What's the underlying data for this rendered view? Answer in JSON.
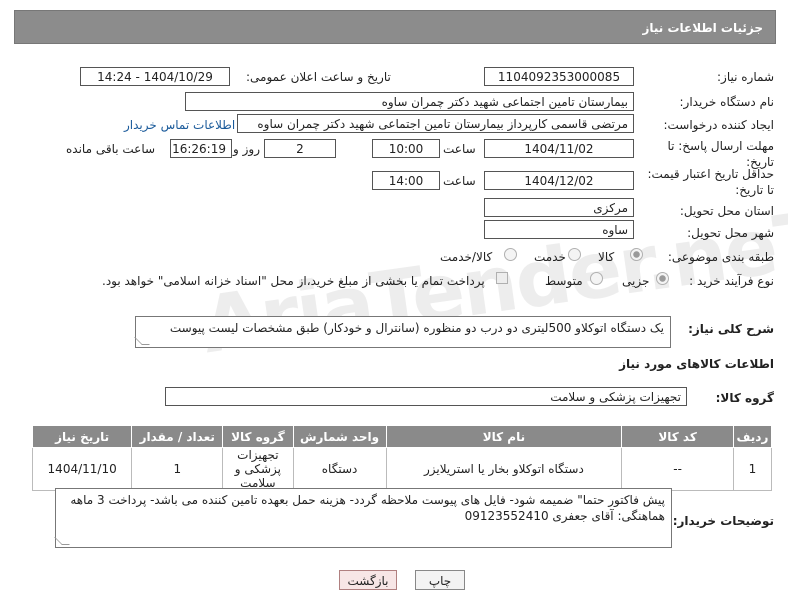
{
  "header": {
    "title": "جزئیات اطلاعات نیاز"
  },
  "need_number": {
    "label": "شماره نیاز:",
    "value": "1104092353000085"
  },
  "announce": {
    "label": "تاریخ و ساعت اعلان عمومی:",
    "value": "1404/10/29 - 14:24"
  },
  "buyer_org": {
    "label": "نام دستگاه خریدار:",
    "value": "بیمارستان تامین اجتماعی شهید دکتر چمران ساوه"
  },
  "requester": {
    "label": "ایجاد کننده درخواست:",
    "value": "مرتضی قاسمی کارپرداز بیمارستان تامین اجتماعی شهید دکتر چمران ساوه",
    "contact_link": "اطلاعات تماس خریدار"
  },
  "reply_deadline": {
    "label_line1": "مهلت ارسال پاسخ: تا",
    "label_line2": "تاریخ:",
    "date": "1404/11/02",
    "time_label": "ساعت",
    "time": "10:00",
    "days": "2",
    "days_label": "روز و",
    "remaining": "16:26:19",
    "remaining_label": "ساعت باقی مانده"
  },
  "price_validity": {
    "label_line1": "حداقل تاریخ اعتبار قیمت:",
    "label_line2": "تا تاریخ:",
    "date": "1404/12/02",
    "time_label": "ساعت",
    "time": "14:00"
  },
  "province": {
    "label": "استان محل تحویل:",
    "value": "مرکزی"
  },
  "city": {
    "label": "شهر محل تحویل:",
    "value": "ساوه"
  },
  "category": {
    "label": "طبقه بندی موضوعی:",
    "options": [
      "کالا",
      "خدمت",
      "کالا/خدمت"
    ],
    "selected": "کالا"
  },
  "process": {
    "label": "نوع فرآیند خرید :",
    "options": [
      "جزیی",
      "متوسط"
    ],
    "payment_note": "پرداخت تمام یا بخشی از مبلغ خرید،از محل \"اسناد خزانه اسلامی\" خواهد بود."
  },
  "general_desc": {
    "label": "شرح کلی نیاز:",
    "value": "یک دستگاه اتوکلاو 500لیتری دو درب دو منظوره (سانترال و خودکار) طبق  مشخصات لیست پیوست"
  },
  "goods_info": {
    "title": "اطلاعات کالاهای مورد نیاز"
  },
  "goods_group": {
    "label": "گروه کالا:",
    "value": "تجهیزات پزشکی و سلامت"
  },
  "table": {
    "headers": [
      "ردیف",
      "کد کالا",
      "نام کالا",
      "واحد شمارش",
      "گروه کالا",
      "تعداد / مقدار",
      "تاریخ نیاز"
    ],
    "rows": [
      {
        "row": "1",
        "code": "--",
        "name": "دستگاه اتوکلاو بخار یا استریلایزر",
        "unit": "دستگاه",
        "group": "تجهیزات پزشکی و سلامت",
        "qty": "1",
        "date": "1404/11/10"
      }
    ]
  },
  "buyer_notes": {
    "label": "توضیحات خریدار:",
    "value": "پیش فاکتور حتما\" ضمیمه شود- فایل های پیوست ملاحظه گردد- هزینه حمل بعهده تامین کننده می باشد- پرداخت 3 ماهه هماهنگی: آقای جعفری 09123552410"
  },
  "buttons": {
    "print": "چاپ",
    "back": "بازگشت"
  },
  "watermark": "AriaTender.neT"
}
